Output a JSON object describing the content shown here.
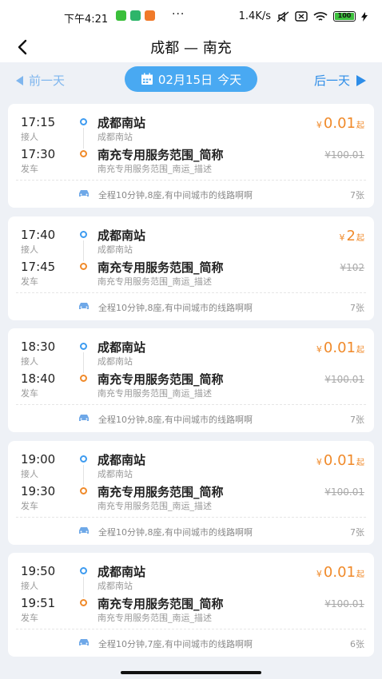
{
  "status_bar": {
    "time": "下午4:21",
    "more": "···",
    "net_speed": "1.4K/s",
    "battery": "100",
    "app_colors": [
      "#3bbf3b",
      "#2db56a",
      "#f07a2a"
    ]
  },
  "header": {
    "title": "成都 — 南充"
  },
  "date_bar": {
    "prev_label": "前一天",
    "date": "02月15日",
    "today": "今天",
    "next_label": "后一天"
  },
  "colors": {
    "accent_blue": "#49a9f2",
    "price_orange": "#f08a2a"
  },
  "trips": [
    {
      "dep_time": "17:15",
      "dep_label": "接人",
      "arr_time": "17:30",
      "arr_label": "发车",
      "dep_station": "成都南站",
      "dep_sub": "成都南站",
      "arr_station": "南充专用服务范围_简称",
      "arr_sub": "南充专用服务范围_南运_描述",
      "currency": "¥",
      "price": "0.01",
      "price_suffix": "起",
      "orig_price": "¥100.01",
      "desc": "全程10分钟,8座,有中间城市的线路啊啊",
      "seats": "7张"
    },
    {
      "dep_time": "17:40",
      "dep_label": "接人",
      "arr_time": "17:45",
      "arr_label": "发车",
      "dep_station": "成都南站",
      "dep_sub": "成都南站",
      "arr_station": "南充专用服务范围_简称",
      "arr_sub": "南充专用服务范围_南运_描述",
      "currency": "¥",
      "price": "2",
      "price_suffix": "起",
      "orig_price": "¥102",
      "desc": "全程10分钟,8座,有中间城市的线路啊啊",
      "seats": "7张"
    },
    {
      "dep_time": "18:30",
      "dep_label": "接人",
      "arr_time": "18:40",
      "arr_label": "发车",
      "dep_station": "成都南站",
      "dep_sub": "成都南站",
      "arr_station": "南充专用服务范围_简称",
      "arr_sub": "南充专用服务范围_南运_描述",
      "currency": "¥",
      "price": "0.01",
      "price_suffix": "起",
      "orig_price": "¥100.01",
      "desc": "全程10分钟,8座,有中间城市的线路啊啊",
      "seats": "7张"
    },
    {
      "dep_time": "19:00",
      "dep_label": "接人",
      "arr_time": "19:30",
      "arr_label": "发车",
      "dep_station": "成都南站",
      "dep_sub": "成都南站",
      "arr_station": "南充专用服务范围_简称",
      "arr_sub": "南充专用服务范围_南运_描述",
      "currency": "¥",
      "price": "0.01",
      "price_suffix": "起",
      "orig_price": "¥100.01",
      "desc": "全程10分钟,8座,有中间城市的线路啊啊",
      "seats": "7张"
    },
    {
      "dep_time": "19:50",
      "dep_label": "接人",
      "arr_time": "19:51",
      "arr_label": "发车",
      "dep_station": "成都南站",
      "dep_sub": "成都南站",
      "arr_station": "南充专用服务范围_简称",
      "arr_sub": "南充专用服务范围_南运_描述",
      "currency": "¥",
      "price": "0.01",
      "price_suffix": "起",
      "orig_price": "¥100.01",
      "desc": "全程10分钟,7座,有中间城市的线路啊啊",
      "seats": "6张"
    }
  ]
}
